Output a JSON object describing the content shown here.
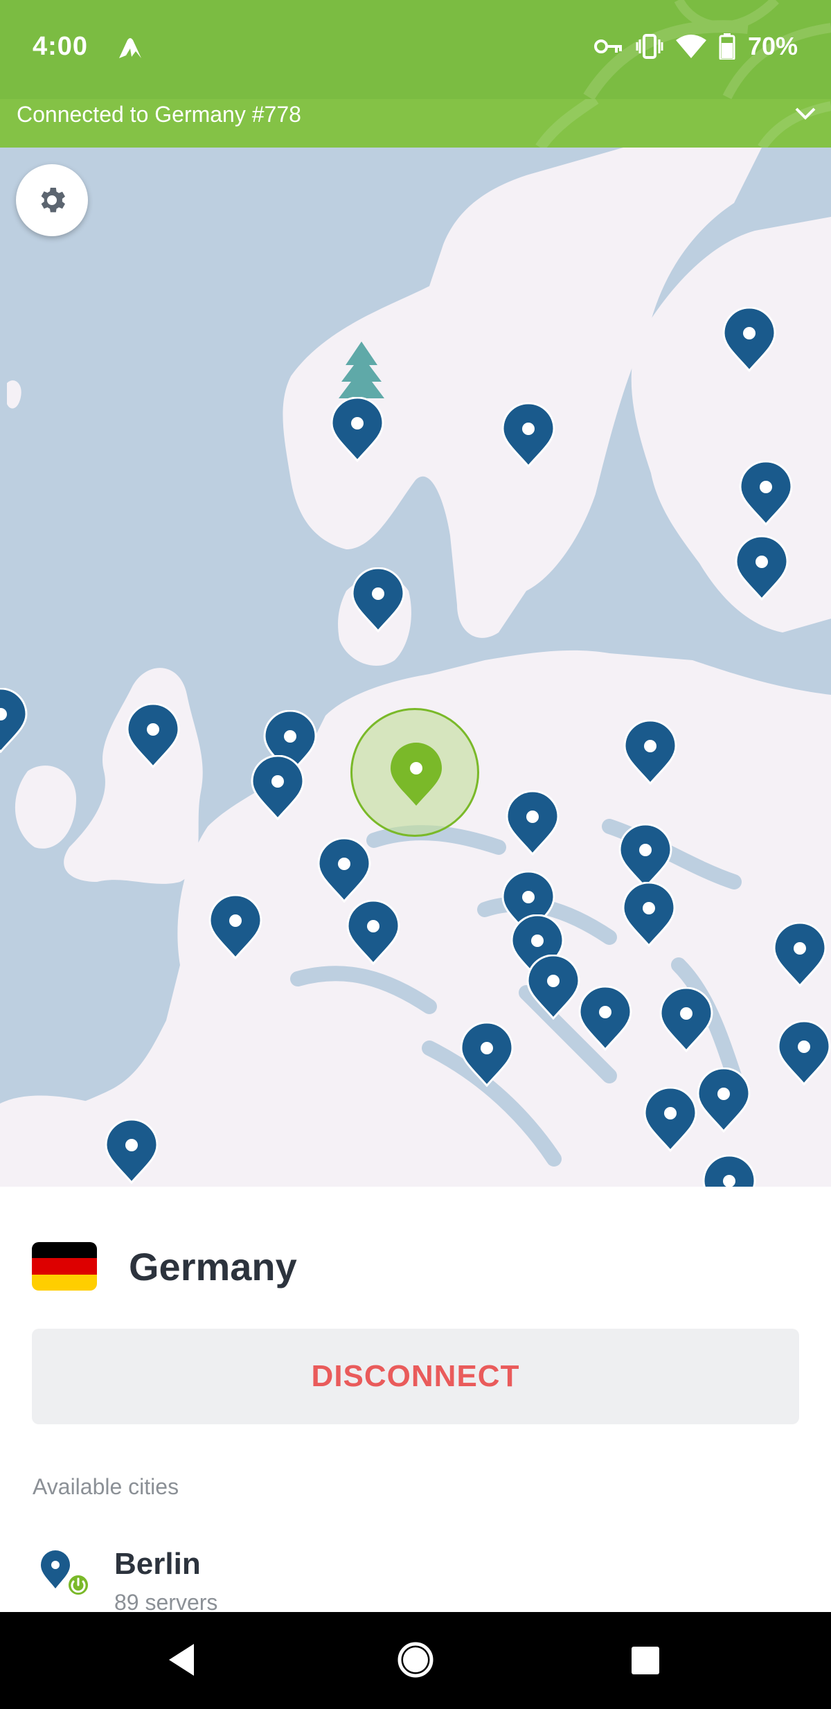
{
  "status_bar": {
    "time": "4:00",
    "battery": "70%",
    "icons": [
      "nordvpn-icon",
      "vpn-key-icon",
      "vibrate-icon",
      "wifi-icon",
      "battery-icon"
    ]
  },
  "connection_bar": {
    "text": "Connected to Germany #778"
  },
  "map": {
    "connected_country": "Germany"
  },
  "panel": {
    "country": "Germany",
    "disconnect_label": "DISCONNECT",
    "cities_label": "Available cities",
    "cities": [
      {
        "name": "Berlin",
        "servers": "89 servers"
      }
    ]
  },
  "colors": {
    "status_green": "#7bbc42",
    "pin_blue": "#1a5a8c",
    "connected_green": "#7ab929",
    "disconnect_red": "#e95b5b",
    "map_water": "#bdcfe0",
    "map_land": "#f5f1f6"
  }
}
